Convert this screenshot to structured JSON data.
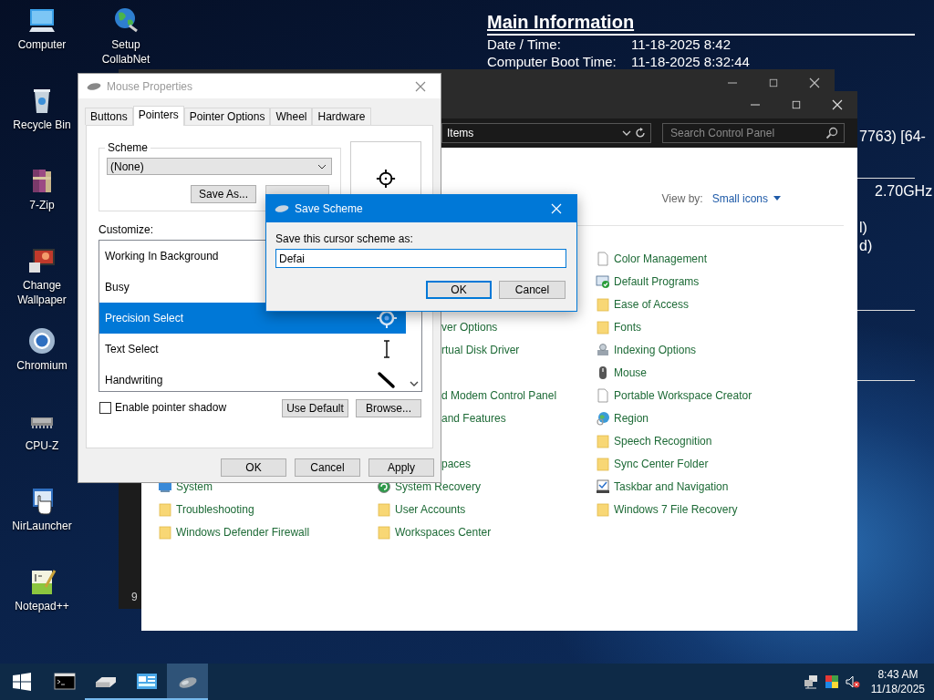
{
  "desktop_icons": [
    {
      "label": "Computer",
      "kind": "computer"
    },
    {
      "label": "Setup CollabNet",
      "kind": "globe"
    },
    {
      "label": "Recycle Bin",
      "kind": "recycle"
    },
    {
      "label": "7-Zip",
      "kind": "archive"
    },
    {
      "label": "Change Wallpaper",
      "kind": "wallpaper"
    },
    {
      "label": "Chromium",
      "kind": "browser"
    },
    {
      "label": "CPU-Z",
      "kind": "chip"
    },
    {
      "label": "NirLauncher",
      "kind": "launcher"
    },
    {
      "label": "Notepad++",
      "kind": "notepad"
    }
  ],
  "info_panel": {
    "title": "Main Information",
    "rows": [
      {
        "label": "Date / Time:",
        "value": "11-18-2025 8:42"
      },
      {
        "label": "Computer Boot Time:",
        "value": "11-18-2025 8:32:44"
      }
    ],
    "fragments": [
      "7763) [64-",
      "2.70GHz",
      "l)",
      "d)"
    ]
  },
  "back_window": {
    "status": "9"
  },
  "control_panel": {
    "address": "Items",
    "search": {
      "placeholder": "Search Control Panel"
    },
    "view_by_label": "View by:",
    "view_by_value": "Small icons",
    "columns": [
      [
        {
          "label": "System",
          "kind": "monitor"
        },
        {
          "label": "Troubleshooting",
          "kind": "folder"
        },
        {
          "label": "Windows Defender Firewall",
          "kind": "folder"
        }
      ],
      [
        {
          "label": "ver Options",
          "kind": "clipped"
        },
        {
          "label": "rtual Disk Driver",
          "kind": "clipped"
        },
        {
          "label": "d Modem Control Panel",
          "kind": "clipped"
        },
        {
          "label": "and Features",
          "kind": "clipped"
        },
        {
          "label": "paces",
          "kind": "clipped"
        },
        {
          "label": "System Recovery",
          "kind": "recovery"
        },
        {
          "label": "User Accounts",
          "kind": "folder"
        },
        {
          "label": "Workspaces Center",
          "kind": "folder"
        }
      ],
      [
        {
          "label": "Color Management",
          "kind": "doc"
        },
        {
          "label": "Default Programs",
          "kind": "programs"
        },
        {
          "label": "Ease of Access",
          "kind": "folder"
        },
        {
          "label": "Fonts",
          "kind": "folder"
        },
        {
          "label": "Indexing Options",
          "kind": "indexing"
        },
        {
          "label": "Mouse",
          "kind": "mouse"
        },
        {
          "label": "Portable Workspace Creator",
          "kind": "doc"
        },
        {
          "label": "Region",
          "kind": "region"
        },
        {
          "label": "Speech Recognition",
          "kind": "folder"
        },
        {
          "label": "Sync Center Folder",
          "kind": "folder"
        },
        {
          "label": "Taskbar and Navigation",
          "kind": "taskbar"
        },
        {
          "label": "Windows 7 File Recovery",
          "kind": "folder"
        }
      ]
    ]
  },
  "mouse_properties": {
    "title": "Mouse Properties",
    "tabs": [
      {
        "label": "Buttons",
        "selected": false
      },
      {
        "label": "Pointers",
        "selected": true
      },
      {
        "label": "Pointer Options",
        "selected": false
      },
      {
        "label": "Wheel",
        "selected": false
      },
      {
        "label": "Hardware",
        "selected": false
      }
    ],
    "scheme_label": "Scheme",
    "scheme_value": "(None)",
    "save_as": "Save As...",
    "customize_label": "Customize:",
    "pointers": [
      {
        "label": "Working In Background",
        "selected": false,
        "kind": "hidden"
      },
      {
        "label": "Busy",
        "selected": false,
        "kind": "hidden"
      },
      {
        "label": "Precision Select",
        "selected": true,
        "kind": "crosshair"
      },
      {
        "label": "Text Select",
        "selected": false,
        "kind": "ibeam"
      },
      {
        "label": "Handwriting",
        "selected": false,
        "kind": "pen"
      }
    ],
    "shadow": {
      "label": "Enable pointer shadow",
      "checked": false
    },
    "buttons": [
      "Use Default",
      "Browse..."
    ],
    "footer_buttons": [
      "OK",
      "Cancel",
      "Apply"
    ]
  },
  "save_scheme": {
    "title": "Save Scheme",
    "prompt": "Save this cursor scheme as:",
    "value": "Defai",
    "buttons": [
      {
        "label": "OK",
        "default": true
      },
      {
        "label": "Cancel",
        "default": false
      }
    ]
  },
  "taskbar": {
    "apps": [
      {
        "kind": "terminal",
        "running": false,
        "active": false
      },
      {
        "kind": "drive",
        "running": true,
        "active": false
      },
      {
        "kind": "cpanel",
        "running": true,
        "active": false
      },
      {
        "kind": "mouse",
        "running": true,
        "active": true
      }
    ],
    "clock": {
      "time": "8:43 AM",
      "date": "11/18/2025"
    }
  }
}
